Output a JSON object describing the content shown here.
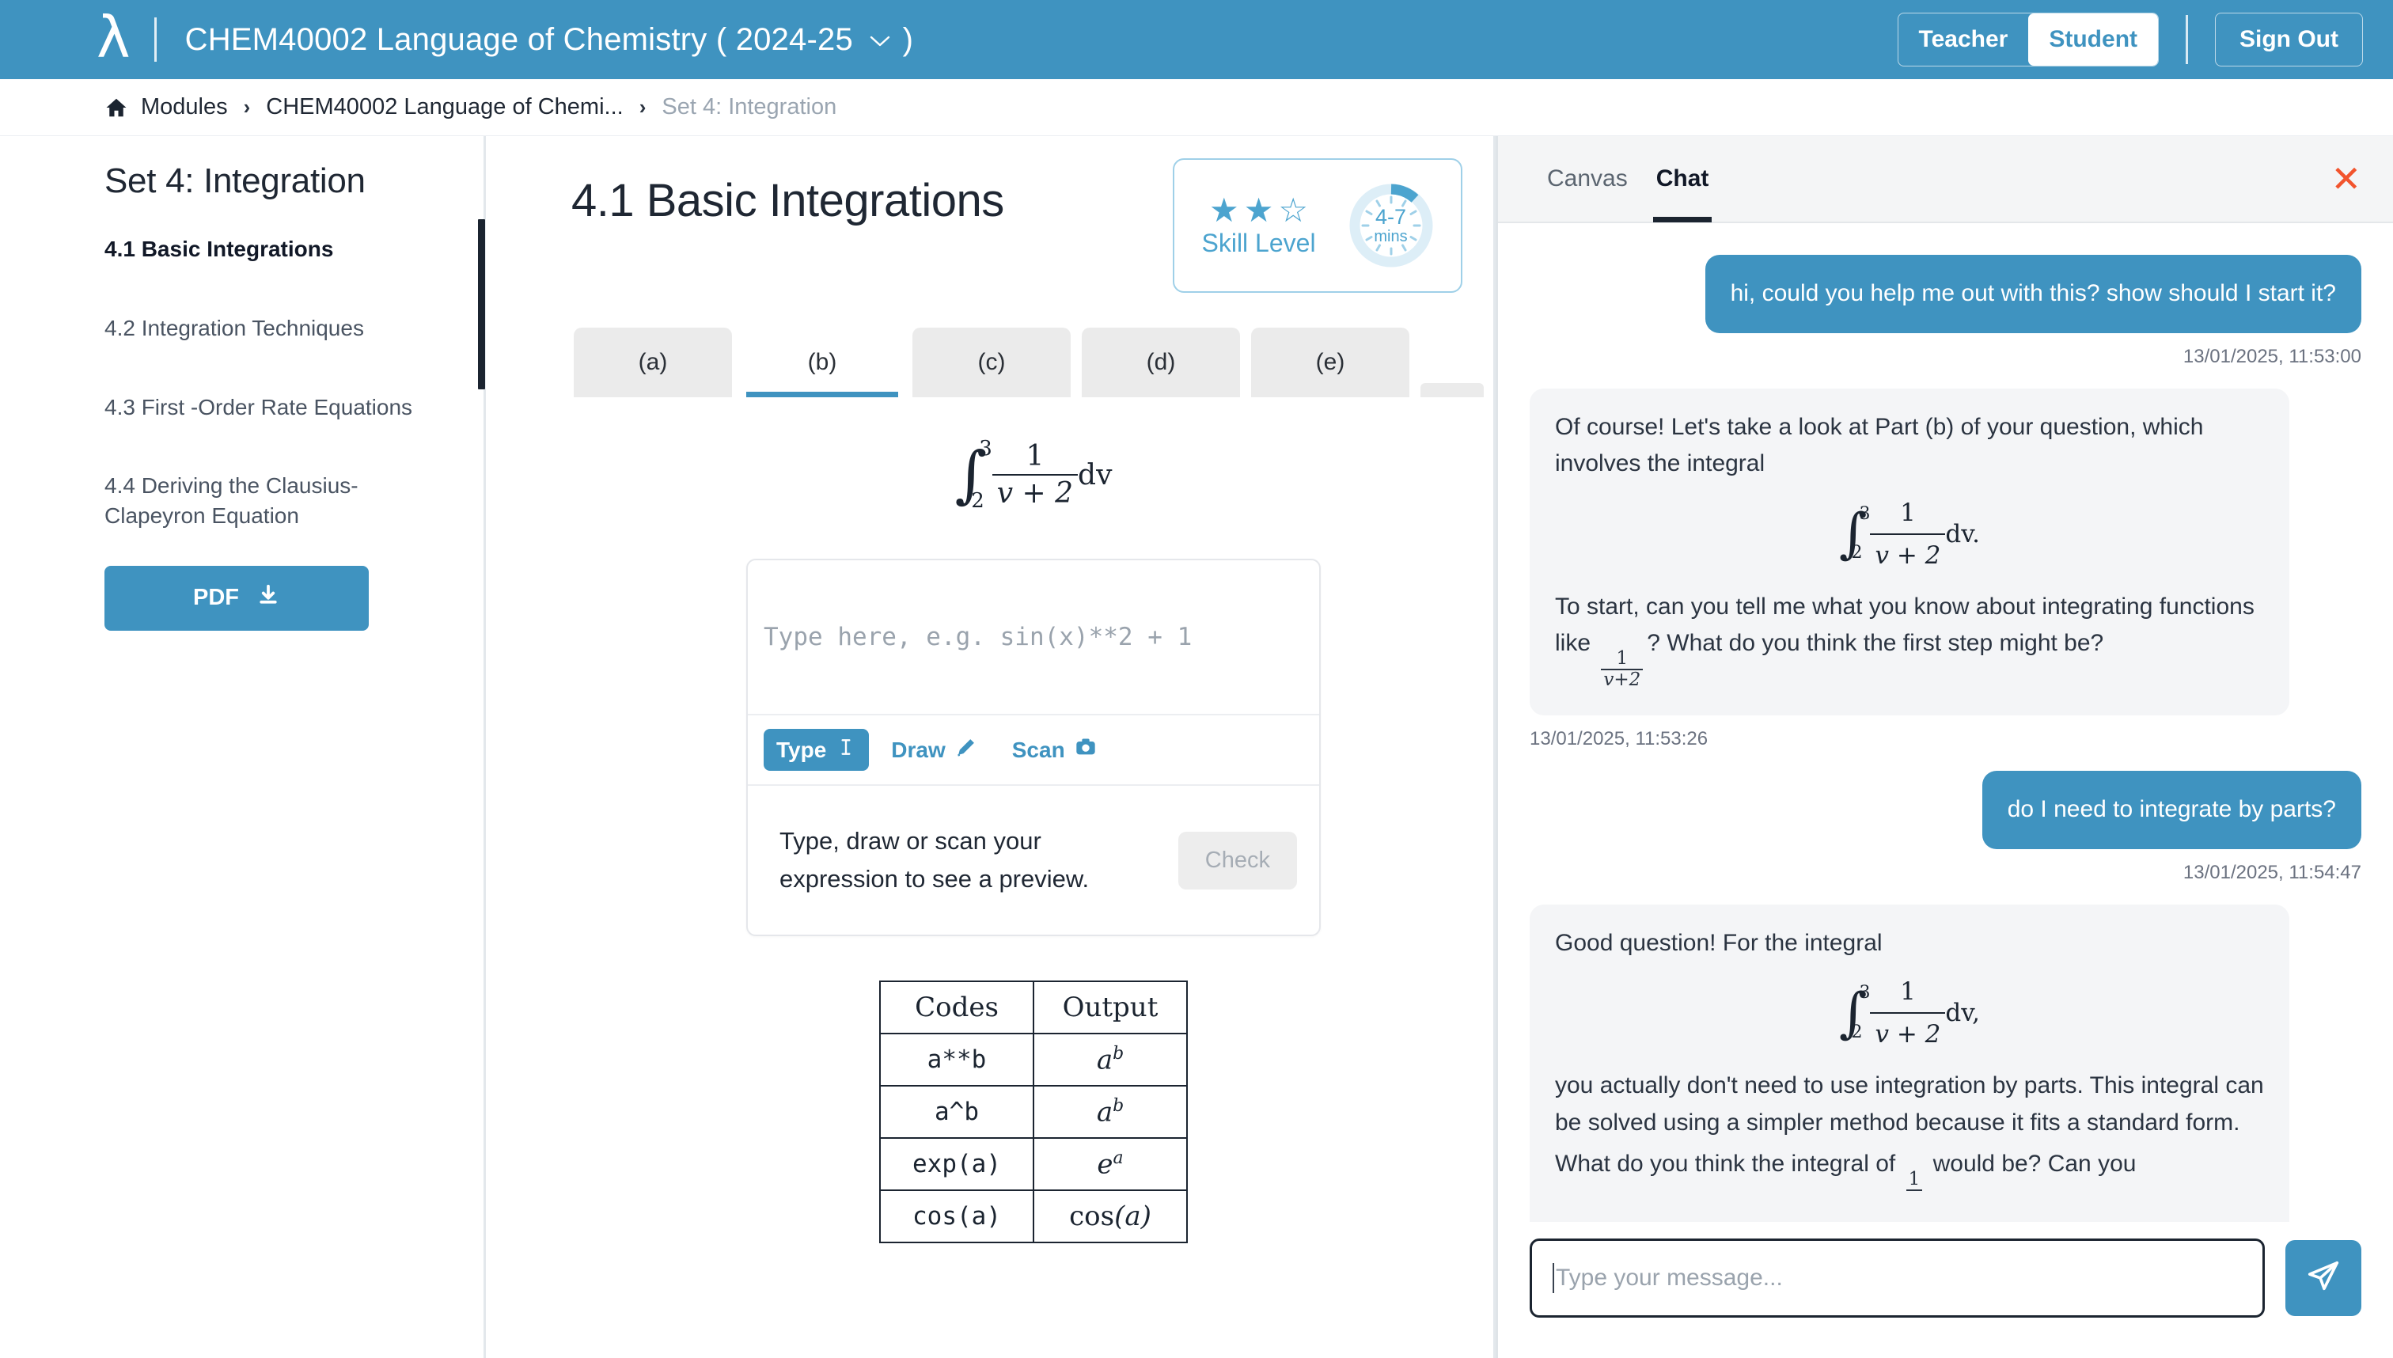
{
  "topbar": {
    "logo": "lambda-logo",
    "course_title": "CHEM40002 Language of Chemistry",
    "year_open_paren": "(",
    "year": "2024-25",
    "year_close_paren": ")",
    "role_teacher": "Teacher",
    "role_student": "Student",
    "active_role": "Student",
    "sign_out": "Sign Out",
    "accent": "#3f93c0"
  },
  "breadcrumb": {
    "home_icon": "home-icon",
    "items": [
      {
        "label": "Modules",
        "muted": false
      },
      {
        "label": "CHEM40002 Language of Chemi...",
        "muted": false
      },
      {
        "label": "Set 4: Integration",
        "muted": true
      }
    ],
    "separator": "›"
  },
  "sidebar": {
    "title": "Set 4: Integration",
    "items": [
      {
        "label": "4.1 Basic Integrations",
        "active": true
      },
      {
        "label": "4.2 Integration Techniques",
        "active": false
      },
      {
        "label": "4.3 First -Order Rate Equations",
        "active": false
      },
      {
        "label": "4.4 Deriving the Clausius-Clapeyron Equation",
        "active": false
      }
    ],
    "pdf_button": "PDF",
    "pdf_icon": "download-icon"
  },
  "main": {
    "title": "4.1 Basic Integrations",
    "skill": {
      "label": "Skill Level",
      "stars_filled": 2,
      "stars_total": 3,
      "time_top": "4-7",
      "time_bottom": "mins",
      "color": "#4ca4cf"
    },
    "tabs": [
      {
        "label": "(a)",
        "active": false
      },
      {
        "label": "(b)",
        "active": true
      },
      {
        "label": "(c)",
        "active": false
      },
      {
        "label": "(d)",
        "active": false
      },
      {
        "label": "(e)",
        "active": false
      }
    ],
    "question_formula": {
      "upper_limit": "3",
      "lower_limit": "2",
      "numerator": "1",
      "denominator": "v + 2",
      "differential": "dv"
    },
    "answer": {
      "placeholder": "Type here, e.g. sin(x)**2 + 1",
      "value": "",
      "tools": [
        {
          "label": "Type",
          "icon": "text-cursor-icon",
          "active": true
        },
        {
          "label": "Draw",
          "icon": "pencil-icon",
          "active": false
        },
        {
          "label": "Scan",
          "icon": "camera-icon",
          "active": false
        }
      ],
      "preview_text": "Type, draw or scan your expression to see a preview.",
      "check_button": "Check"
    },
    "codes_table": {
      "headers": [
        "Codes",
        "Output"
      ],
      "rows": [
        {
          "code": "a**b",
          "out_base": "a",
          "out_sup": "b",
          "out_fn": ""
        },
        {
          "code": "a^b",
          "out_base": "a",
          "out_sup": "b",
          "out_fn": ""
        },
        {
          "code": "exp(a)",
          "out_base": "e",
          "out_sup": "a",
          "out_fn": ""
        },
        {
          "code": "cos(a)",
          "out_base": "a",
          "out_sup": "",
          "out_fn": "cos"
        }
      ]
    }
  },
  "chat": {
    "tabs": [
      {
        "label": "Canvas",
        "active": false
      },
      {
        "label": "Chat",
        "active": true
      }
    ],
    "close_icon": "close-icon",
    "messages": [
      {
        "role": "user",
        "text": "hi, could you help me out with this? show should I start it?",
        "timestamp": "13/01/2025, 11:53:00"
      },
      {
        "role": "bot",
        "para1": "Of course! Let's take a look at Part (b) of your question, which involves the integral",
        "formula": {
          "upper_limit": "3",
          "lower_limit": "2",
          "numerator": "1",
          "denominator": "v + 2",
          "differential": "dv."
        },
        "para2_a": "To start, can you tell me what you know about integrating functions like",
        "inline_frac": {
          "num": "1",
          "den": "v+2"
        },
        "para2_b": "? What do you think the first step might be?",
        "timestamp": "13/01/2025, 11:53:26"
      },
      {
        "role": "user",
        "text": "do I need to integrate by parts?",
        "timestamp": "13/01/2025, 11:54:47"
      },
      {
        "role": "bot",
        "para1": "Good question! For the integral",
        "formula": {
          "upper_limit": "3",
          "lower_limit": "2",
          "numerator": "1",
          "denominator": "v + 2",
          "differential": "dv,"
        },
        "para2_a": "you actually don't need to use integration by parts. This integral can be solved using a simpler method because it fits a standard form.",
        "para3_a": "What do you think the integral of",
        "inline_frac": {
          "num": "1",
          "den": ""
        },
        "para3_b": "would be? Can you",
        "timestamp": ""
      }
    ],
    "input": {
      "placeholder": "Type your message...",
      "value": ""
    },
    "send_icon": "send-icon"
  }
}
